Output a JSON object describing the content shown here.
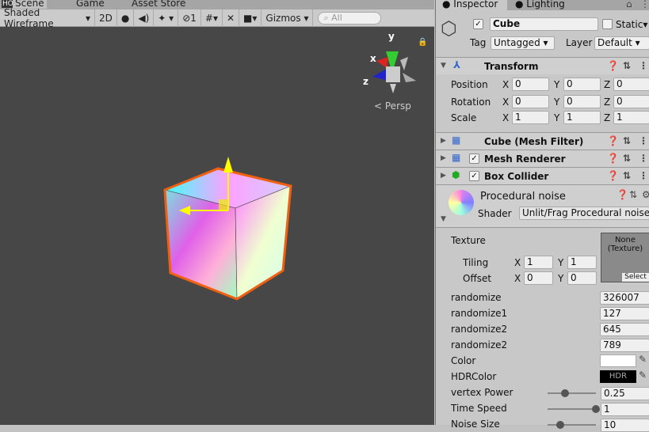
{
  "scene_tabs": [
    "Scene",
    "Game",
    "Asset Store"
  ],
  "watermark": "HONEYCAM",
  "toolbar": {
    "draw_mode": "Shaded Wireframe",
    "mode_2d": "2D",
    "hidden_count": "1",
    "gizmos": "Gizmos",
    "search_placeholder": "All"
  },
  "gizmo": {
    "y": "y",
    "x": "x",
    "z": "z",
    "projection": "Persp"
  },
  "inspector": {
    "tabs": [
      "Inspector",
      "Lighting"
    ],
    "object_name": "Cube",
    "static_label": "Static",
    "tag_label": "Tag",
    "tag_value": "Untagged",
    "layer_label": "Layer",
    "layer_value": "Default",
    "transform": {
      "title": "Transform",
      "rows": [
        {
          "label": "Position",
          "x": "0",
          "y": "0",
          "z": "0"
        },
        {
          "label": "Rotation",
          "x": "0",
          "y": "0",
          "z": "0"
        },
        {
          "label": "Scale",
          "x": "1",
          "y": "1",
          "z": "1"
        }
      ]
    },
    "components": [
      "Cube (Mesh Filter)",
      "Mesh Renderer",
      "Box Collider"
    ],
    "material": {
      "name": "Procedural noise",
      "shader_label": "Shader",
      "shader_value": "Unlit/Frag Procedural noise",
      "texture_label": "Texture",
      "texture_none": "None\n(Texture)",
      "select": "Select",
      "tiling_label": "Tiling",
      "tiling_x": "1",
      "tiling_y": "1",
      "offset_label": "Offset",
      "offset_x": "0",
      "offset_y": "0",
      "props": [
        {
          "label": "randomize",
          "value": "326007"
        },
        {
          "label": "randomize1",
          "value": "127"
        },
        {
          "label": "randomize2",
          "value": "645"
        },
        {
          "label": "randomize2",
          "value": "789"
        }
      ],
      "color_label": "Color",
      "hdr_label": "HDRColor",
      "hdr_text": "HDR",
      "sliders": [
        {
          "label": "vertex Power",
          "value": "0.25",
          "fraction": 0.3
        },
        {
          "label": "Time Speed",
          "value": "1",
          "fraction": 1.0
        },
        {
          "label": "Noise Size",
          "value": "10",
          "fraction": 0.2
        }
      ]
    }
  }
}
